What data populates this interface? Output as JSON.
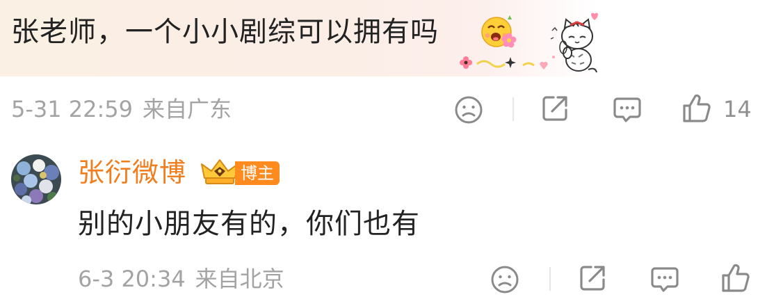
{
  "comment": {
    "text": "张老师，一个小小剧综可以拥有吗",
    "time": "5-31 22:59",
    "source": "来自广东",
    "like_count": "14",
    "emoji": "flower-face-emoji",
    "sticker": "cat-sticker"
  },
  "reply": {
    "author": "张衍微博",
    "badge": "博主",
    "text": "别的小朋友有的，你们也有",
    "time": "6-3 20:34",
    "source": "来自北京"
  },
  "icons": {
    "dislike": "sad-face-icon",
    "share": "share-icon",
    "comment": "comment-icon",
    "like": "thumbs-up-icon"
  },
  "colors": {
    "author": "#f07e1e",
    "badge": "#ff8a1d",
    "meta": "#a3a3a3",
    "text": "#222222",
    "icon": "#8a8a8a"
  }
}
